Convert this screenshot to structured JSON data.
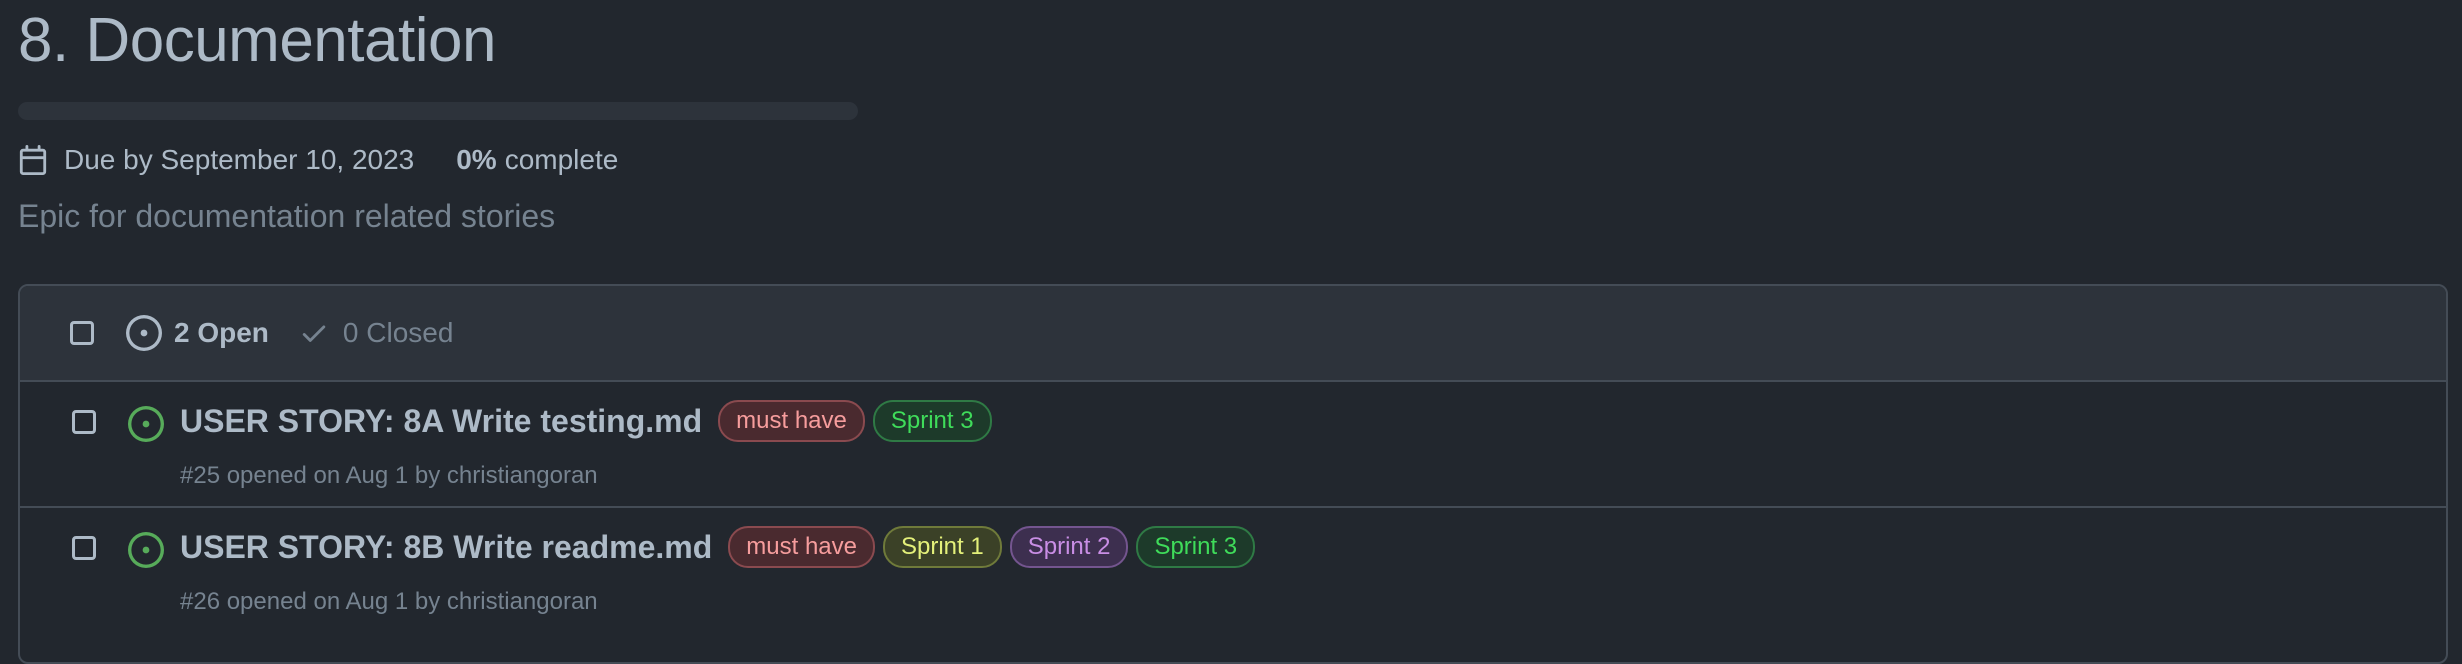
{
  "milestone": {
    "title": "8. Documentation",
    "progress_percent": 0,
    "due_text": "Due by September 10, 2023",
    "percent_text": "0%",
    "percent_label": "complete",
    "description": "Epic for documentation related stories"
  },
  "list_header": {
    "open_label": "2 Open",
    "closed_label": "0 Closed"
  },
  "issues": [
    {
      "title": "USER STORY: 8A Write testing.md",
      "meta": "#25 opened on Aug 1 by christiangoran",
      "labels": [
        "must have",
        "Sprint 3"
      ]
    },
    {
      "title": "USER STORY: 8B Write readme.md",
      "meta": "#26 opened on Aug 1 by christiangoran",
      "labels": [
        "must have",
        "Sprint 1",
        "Sprint 2",
        "Sprint 3"
      ]
    }
  ],
  "label_colors": {
    "must have": {
      "text": "#f69d9d",
      "bg": "#4a2a2f",
      "border": "#8a4a4f"
    },
    "Sprint 1": {
      "text": "#e4f07a",
      "bg": "#3b4127",
      "border": "#6f7a3a"
    },
    "Sprint 2": {
      "text": "#c98ee5",
      "bg": "#3d2f4f",
      "border": "#74558f"
    },
    "Sprint 3": {
      "text": "#3fdc5a",
      "bg": "#1d3a2a",
      "border": "#2f7a45"
    }
  },
  "colors": {
    "open_icon": "#57ab5a",
    "background": "#22272e"
  }
}
